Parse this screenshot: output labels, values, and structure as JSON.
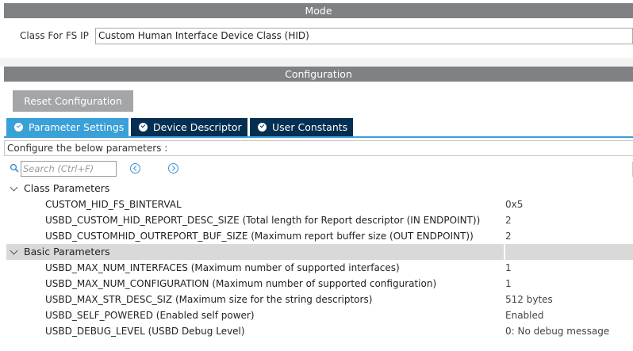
{
  "mode": {
    "header": "Mode",
    "class_label": "Class For FS IP",
    "class_value": "Custom Human Interface Device Class (HID)"
  },
  "configuration": {
    "header": "Configuration",
    "reset_label": "Reset Configuration",
    "tabs": [
      {
        "label": "Parameter Settings",
        "active": true
      },
      {
        "label": "Device Descriptor",
        "active": false
      },
      {
        "label": "User Constants",
        "active": false
      }
    ],
    "instruction": "Configure the below parameters :",
    "search_placeholder": "Search (Ctrl+F)"
  },
  "groups": [
    {
      "label": "Class Parameters",
      "params": [
        {
          "name": "CUSTOM_HID_FS_BINTERVAL",
          "value": "0x5"
        },
        {
          "name": "USBD_CUSTOM_HID_REPORT_DESC_SIZE (Total length for Report descriptor (IN ENDPOINT))",
          "value": "2"
        },
        {
          "name": "USBD_CUSTOMHID_OUTREPORT_BUF_SIZE (Maximum report buffer size (OUT ENDPOINT))",
          "value": "2"
        }
      ]
    },
    {
      "label": "Basic Parameters",
      "params": [
        {
          "name": "USBD_MAX_NUM_INTERFACES (Maximum number of supported interfaces)",
          "value": "1"
        },
        {
          "name": "USBD_MAX_NUM_CONFIGURATION (Maximum number of supported configuration)",
          "value": "1"
        },
        {
          "name": "USBD_MAX_STR_DESC_SIZ (Maximum size for the string descriptors)",
          "value": "512 bytes"
        },
        {
          "name": "USBD_SELF_POWERED (Enabled self power)",
          "value": "Enabled"
        },
        {
          "name": "USBD_DEBUG_LEVEL (USBD Debug Level)",
          "value": "0: No debug message"
        }
      ]
    }
  ],
  "colors": {
    "header_bg": "#7f8184",
    "tab_active": "#3aa0d8",
    "tab_inactive": "#042f52",
    "button_bg": "#a3a5a8"
  }
}
